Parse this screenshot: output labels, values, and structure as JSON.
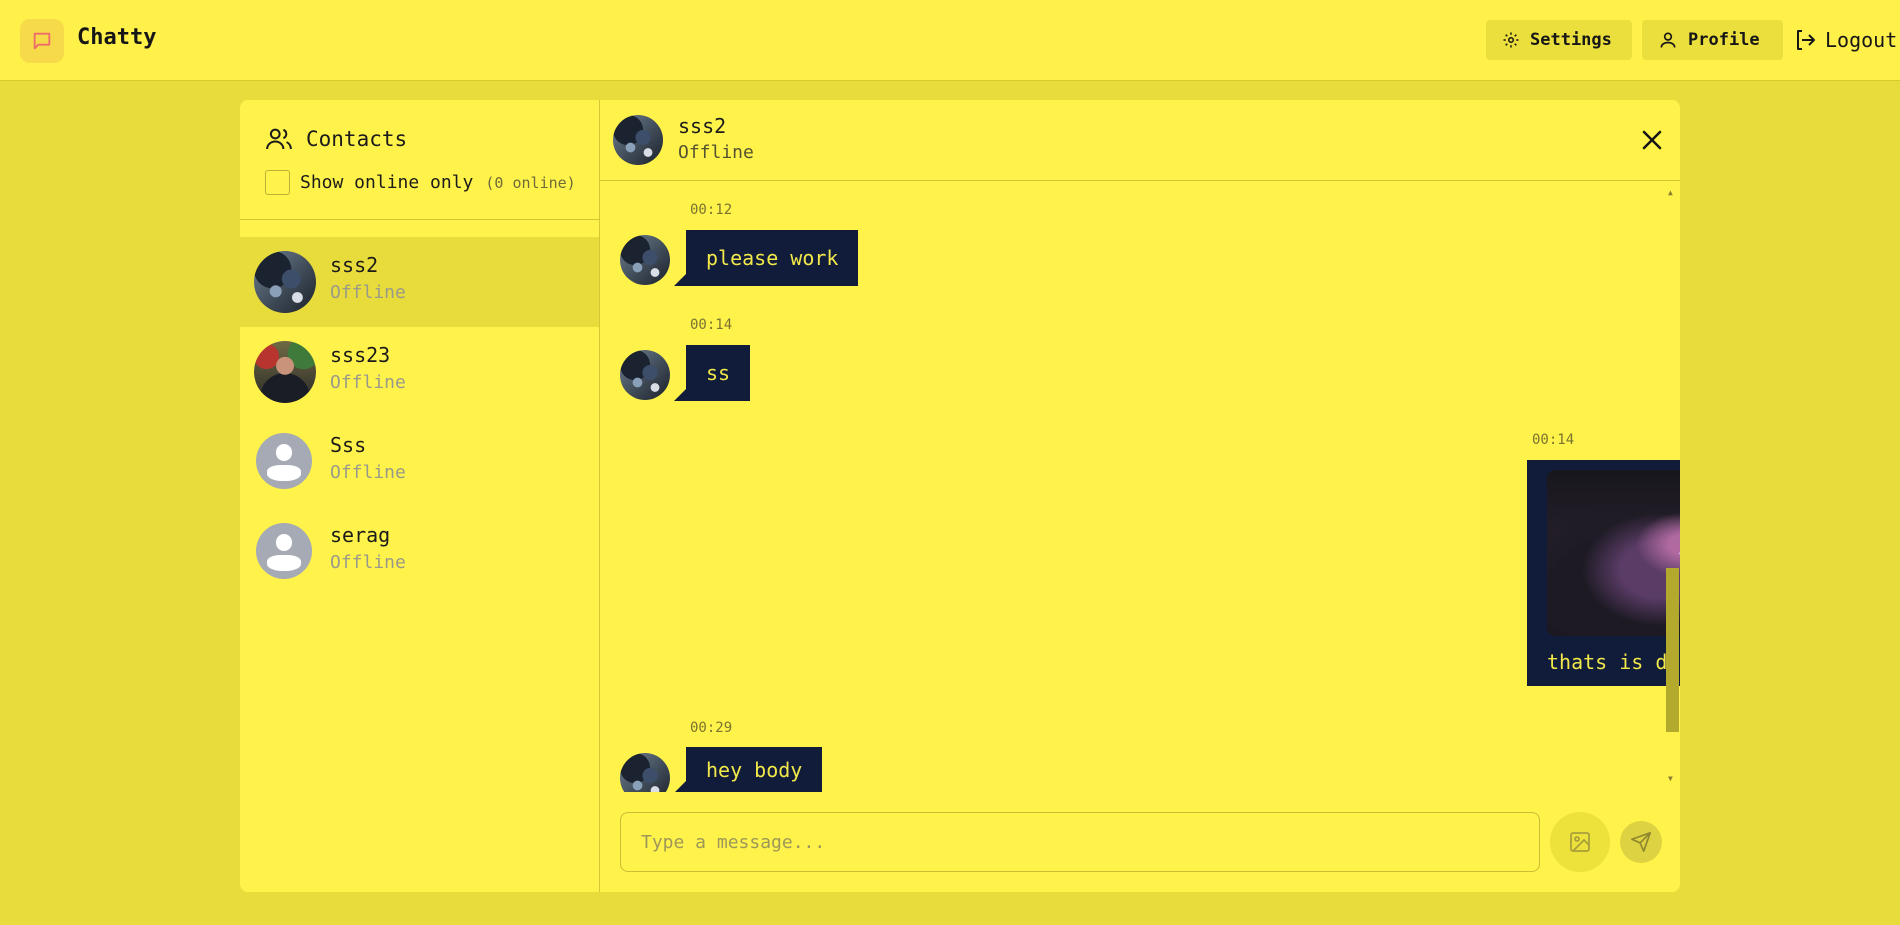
{
  "app": {
    "title": "Chatty",
    "nav": {
      "settings_label": "Settings",
      "profile_label": "Profile",
      "logout_label": "Logout"
    }
  },
  "sidebar": {
    "title": "Contacts",
    "filter_label": "Show online only",
    "online_count": "(0 online)",
    "contacts": [
      {
        "name": "sss2",
        "status": "Offline",
        "avatar": "photo-dark-art",
        "active": true
      },
      {
        "name": "sss23",
        "status": "Offline",
        "avatar": "photo-person",
        "active": false
      },
      {
        "name": "Sss",
        "status": "Offline",
        "avatar": "default-user-icon",
        "active": false
      },
      {
        "name": "serag",
        "status": "Offline",
        "avatar": "default-user-icon",
        "active": false
      }
    ]
  },
  "chat": {
    "contact_name": "sss2",
    "contact_status": "Offline",
    "messages": [
      {
        "time": "00:12",
        "text": "please work",
        "side": "left"
      },
      {
        "time": "00:14",
        "text": "ss",
        "side": "left"
      },
      {
        "time": "00:14",
        "text": "thats is dope",
        "side": "right",
        "has_image": true
      },
      {
        "time": "00:29",
        "text": "hey body",
        "side": "left"
      }
    ],
    "composer": {
      "placeholder": "Type a message..."
    }
  },
  "colors": {
    "background": "#e8dc3c",
    "surface": "#fff24a",
    "bubble": "#111c3a",
    "bubble_text": "#f2e84a",
    "logo_icon": "#ef6b6b"
  }
}
